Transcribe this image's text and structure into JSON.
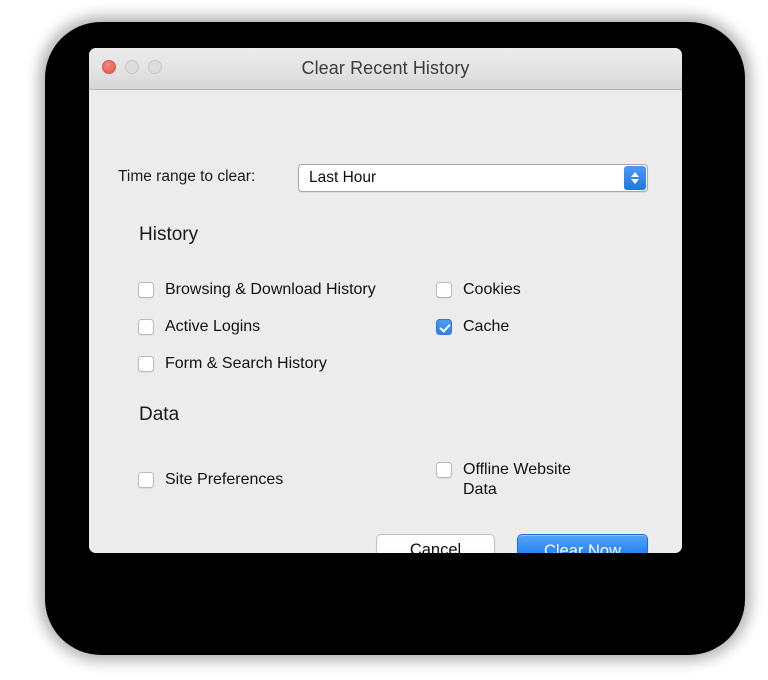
{
  "window": {
    "title": "Clear Recent History",
    "traffic_lights": [
      {
        "name": "close",
        "state": "active",
        "color": "#e8685c"
      },
      {
        "name": "minimize",
        "state": "inactive",
        "color": "#dcdcdc"
      },
      {
        "name": "zoom",
        "state": "inactive",
        "color": "#dcdcdc"
      }
    ]
  },
  "time_range": {
    "label": "Time range to clear:",
    "selected": "Last Hour",
    "arrows_icon": "chevron-up-down-icon",
    "accent": "#2a83ef"
  },
  "history_section": {
    "title": "History",
    "items": [
      {
        "label": "Browsing & Download History",
        "checked": false,
        "column": "left"
      },
      {
        "label": "Active Logins",
        "checked": false,
        "column": "left"
      },
      {
        "label": "Form & Search History",
        "checked": false,
        "column": "left"
      },
      {
        "label": "Cookies",
        "checked": false,
        "column": "right"
      },
      {
        "label": "Cache",
        "checked": true,
        "column": "right"
      }
    ]
  },
  "data_section": {
    "title": "Data",
    "items": [
      {
        "label": "Site Preferences",
        "checked": false,
        "column": "left"
      },
      {
        "label": "Offline Website\nData",
        "checked": false,
        "column": "right"
      }
    ]
  },
  "buttons": {
    "cancel": "Cancel",
    "clear_now": "Clear Now",
    "default_button_color": "#2f8bf2"
  }
}
